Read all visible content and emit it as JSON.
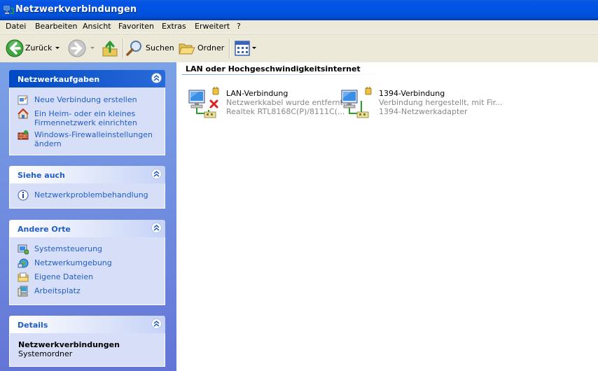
{
  "window": {
    "title": "Netzwerkverbindungen"
  },
  "menu": [
    "Datei",
    "Bearbeiten",
    "Ansicht",
    "Favoriten",
    "Extras",
    "Erweitert",
    "?"
  ],
  "toolbar": {
    "back": "Zurück",
    "search": "Suchen",
    "folders": "Ordner"
  },
  "taskpane": {
    "network_tasks": {
      "title": "Netzwerkaufgaben",
      "items": [
        {
          "label": "Neue Verbindung erstellen"
        },
        {
          "label": "Ein Heim- oder ein kleines Firmennetzwerk einrichten"
        },
        {
          "label": "Windows-Firewalleinstellungen ändern"
        }
      ]
    },
    "see_also": {
      "title": "Siehe auch",
      "items": [
        {
          "label": "Netzwerkproblembehandlung"
        }
      ]
    },
    "other_places": {
      "title": "Andere Orte",
      "items": [
        {
          "label": "Systemsteuerung"
        },
        {
          "label": "Netzwerkumgebung"
        },
        {
          "label": "Eigene Dateien"
        },
        {
          "label": "Arbeitsplatz"
        }
      ]
    },
    "details": {
      "title": "Details",
      "name": "Netzwerkverbindungen",
      "type": "Systemordner"
    }
  },
  "content": {
    "group": "LAN oder Hochgeschwindigkeitsinternet",
    "connections": [
      {
        "name": "LAN-Verbindung",
        "status": "Netzwerkkabel wurde entfernt...",
        "device": "Realtek RTL8168C(P)/8111C(...",
        "icon": "network-disconnected-icon"
      },
      {
        "name": "1394-Verbindung",
        "status": "Verbindung hergestellt, mit Fir...",
        "device": "1394-Netzwerkadapter",
        "icon": "network-connected-icon"
      }
    ]
  }
}
